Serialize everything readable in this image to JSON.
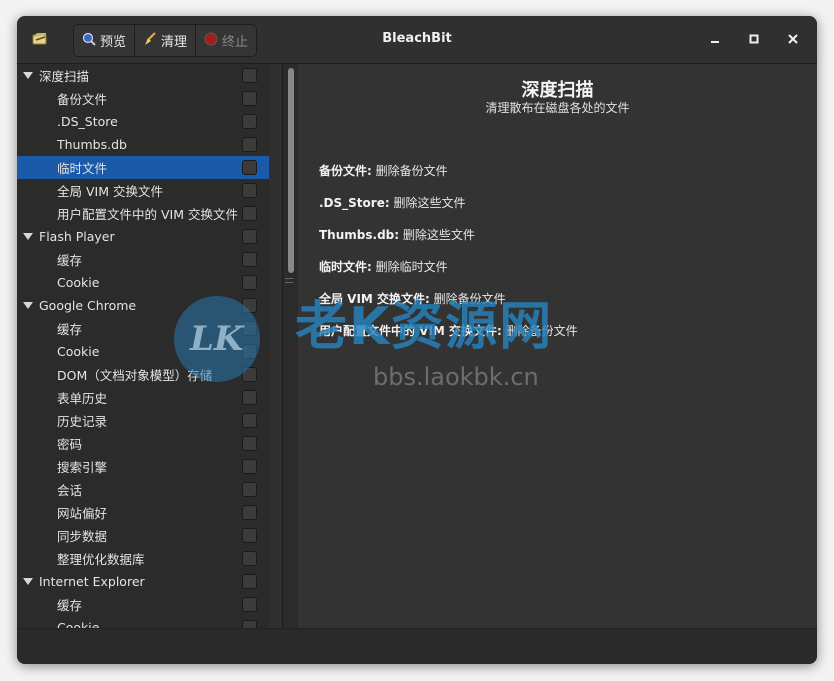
{
  "window": {
    "title": "BleachBit"
  },
  "toolbar": [
    {
      "label": "预览",
      "icon": "magnifier-icon",
      "enabled": true
    },
    {
      "label": "清理",
      "icon": "broom-icon",
      "enabled": true
    },
    {
      "label": "终止",
      "icon": "stop-icon",
      "enabled": false
    }
  ],
  "tree": [
    {
      "label": "深度扫描",
      "level": 0,
      "expanded": true,
      "checked": false,
      "selected": false
    },
    {
      "label": "备份文件",
      "level": 1,
      "checked": false,
      "selected": false
    },
    {
      "label": ".DS_Store",
      "level": 1,
      "checked": false,
      "selected": false
    },
    {
      "label": "Thumbs.db",
      "level": 1,
      "checked": false,
      "selected": false
    },
    {
      "label": "临时文件",
      "level": 1,
      "checked": false,
      "selected": true
    },
    {
      "label": "全局 VIM 交换文件",
      "level": 1,
      "checked": false,
      "selected": false
    },
    {
      "label": "用户配置文件中的 VIM 交换文件",
      "level": 1,
      "checked": false,
      "selected": false
    },
    {
      "label": "Flash Player",
      "level": 0,
      "expanded": true,
      "checked": false,
      "selected": false
    },
    {
      "label": "缓存",
      "level": 1,
      "checked": false,
      "selected": false
    },
    {
      "label": "Cookie",
      "level": 1,
      "checked": false,
      "selected": false
    },
    {
      "label": "Google Chrome",
      "level": 0,
      "expanded": true,
      "checked": false,
      "selected": false
    },
    {
      "label": "缓存",
      "level": 1,
      "checked": false,
      "selected": false
    },
    {
      "label": "Cookie",
      "level": 1,
      "checked": false,
      "selected": false
    },
    {
      "label": "DOM（文档对象模型）存储",
      "level": 1,
      "checked": false,
      "selected": false
    },
    {
      "label": "表单历史",
      "level": 1,
      "checked": false,
      "selected": false
    },
    {
      "label": "历史记录",
      "level": 1,
      "checked": false,
      "selected": false
    },
    {
      "label": "密码",
      "level": 1,
      "checked": false,
      "selected": false
    },
    {
      "label": "搜索引擎",
      "level": 1,
      "checked": false,
      "selected": false
    },
    {
      "label": "会话",
      "level": 1,
      "checked": false,
      "selected": false
    },
    {
      "label": "网站偏好",
      "level": 1,
      "checked": false,
      "selected": false
    },
    {
      "label": "同步数据",
      "level": 1,
      "checked": false,
      "selected": false
    },
    {
      "label": "整理优化数据库",
      "level": 1,
      "checked": false,
      "selected": false
    },
    {
      "label": "Internet Explorer",
      "level": 0,
      "expanded": true,
      "checked": false,
      "selected": false
    },
    {
      "label": "缓存",
      "level": 1,
      "checked": false,
      "selected": false
    },
    {
      "label": "Cookie",
      "level": 1,
      "checked": false,
      "selected": false
    }
  ],
  "content": {
    "title": "深度扫描",
    "subtitle": "清理散布在磁盘各处的文件",
    "descriptions": [
      {
        "name": "备份文件:",
        "text": "删除备份文件"
      },
      {
        "name": ".DS_Store:",
        "text": "删除这些文件"
      },
      {
        "name": "Thumbs.db:",
        "text": "删除这些文件"
      },
      {
        "name": "临时文件:",
        "text": "删除临时文件"
      },
      {
        "name": "全局 VIM 交换文件:",
        "text": "删除备份文件"
      },
      {
        "name": "用户配置文件中的 VIM 交换文件:",
        "text": "删除备份文件"
      }
    ]
  },
  "watermark": {
    "logo_text": "LK",
    "main": "老K资源网",
    "url": "bbs.laokbk.cn"
  },
  "colors": {
    "selection": "#1b5aa8",
    "window_bg": "#2b2b2b",
    "content_bg": "#333333",
    "watermark_blue": "#2482be"
  }
}
